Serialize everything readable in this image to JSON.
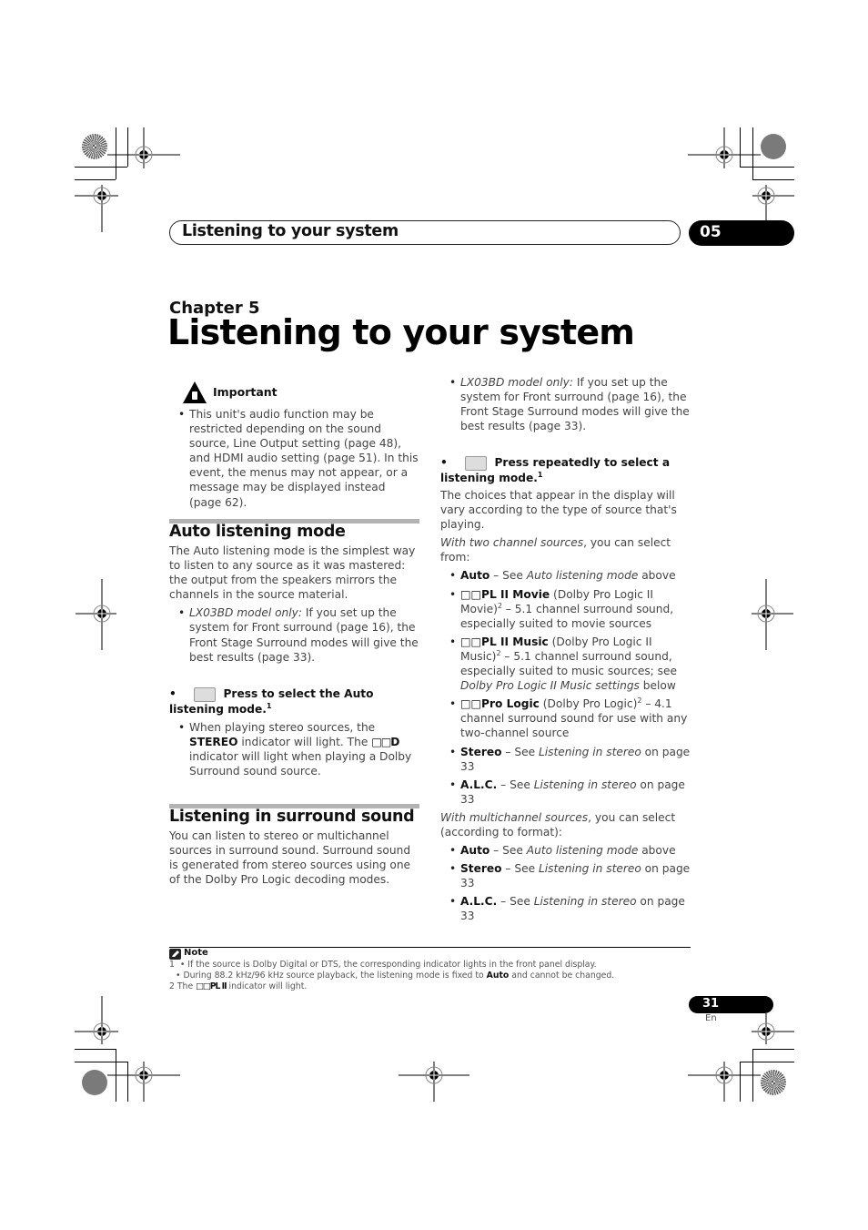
{
  "header": {
    "section_title": "Listening to your system",
    "chapter_number": "05"
  },
  "chapter": {
    "label": "Chapter 5",
    "title": "Listening to your system"
  },
  "important": {
    "label": "Important",
    "icon": "warning-hand-icon",
    "text": "This unit's audio function may be restricted depending on the sound source, Line Output setting (page 48), and HDMI audio setting (page 51). In this event, the menus may not appear, or a message may be displayed instead (page 62)."
  },
  "auto_listening": {
    "title": "Auto listening mode",
    "body": "The Auto listening mode is the simplest way to listen to any source as it was mastered: the output from the speakers mirrors the channels in the source material.",
    "note_italic": "LX03BD model only:",
    "note_text": " If you set up the system for Front surround (page 16), the Front Stage Surround modes will give the best results (page 33).",
    "step_text": "Press to select the Auto listening mode.",
    "step_sup": "1",
    "sub1": "When playing stereo sources, the ",
    "sub_bold1": "STEREO",
    "sub2": " indicator will light. The ",
    "sub_bold2": "□□D",
    "sub3": " indicator will light when playing a Dolby Surround sound source."
  },
  "surround": {
    "title": "Listening in surround sound",
    "body": "You can listen to stereo or multichannel sources in surround sound. Surround sound is generated from stereo sources using one of the Dolby Pro Logic decoding modes.",
    "note_italic": "LX03BD model only:",
    "note_text": " If you set up the system for Front surround (page 16), the Front Stage Surround modes will give the best results (page 33).",
    "step_text": "Press repeatedly to select a listening mode.",
    "step_sup": "1",
    "choices_text": "The choices that appear in the display will vary according to the type of source that's playing.",
    "two_ch_intro_italic": "With two channel sources",
    "two_ch_intro_rest": ", you can select from:",
    "two_ch_items": [
      {
        "bold": "Auto",
        "rest": " – See ",
        "italic": "Auto listening mode",
        "tail": " above"
      },
      {
        "bold": "□□PL II Movie",
        "rest": " (Dolby Pro Logic II Movie)",
        "sup": "2",
        "tail": " – 5.1 channel surround sound, especially suited to movie sources"
      },
      {
        "bold": "□□PL II Music",
        "rest": " (Dolby Pro Logic II Music)",
        "sup": "2",
        "tail": " – 5.1 channel surround sound, especially suited to music sources; see ",
        "italic": "Dolby Pro Logic II Music settings",
        "tail2": " below"
      },
      {
        "bold": "□□Pro Logic",
        "rest": " (Dolby Pro Logic)",
        "sup": "2",
        "tail": " – 4.1 channel surround sound for use with any two-channel source"
      },
      {
        "bold": "Stereo",
        "rest": " – See ",
        "italic": "Listening in stereo",
        "tail": " on page 33"
      },
      {
        "bold": "A.L.C.",
        "rest": " – See ",
        "italic": "Listening in stereo",
        "tail": " on page 33"
      }
    ],
    "multi_intro_italic": "With multichannel sources",
    "multi_intro_rest": ", you can select (according to format):",
    "multi_items": [
      {
        "bold": "Auto",
        "rest": " – See ",
        "italic": "Auto listening mode",
        "tail": " above"
      },
      {
        "bold": "Stereo",
        "rest": " – See ",
        "italic": "Listening in stereo",
        "tail": " on page 33"
      },
      {
        "bold": "A.L.C.",
        "rest": " – See ",
        "italic": "Listening in stereo",
        "tail": " on page 33"
      }
    ]
  },
  "note": {
    "label": "Note",
    "line1_num": "1",
    "line1": "• If the source is Dolby Digital or DTS, the corresponding indicator lights in the front panel display.",
    "line2_a": "• During 88.2 kHz/96 kHz source playback, the listening mode is fixed to ",
    "line2_bold": "Auto",
    "line2_b": " and cannot be changed.",
    "line3_a": "2 The ",
    "line3_bold": "□□PL II",
    "line3_b": " indicator will light."
  },
  "footer": {
    "page_number": "31",
    "language": "En"
  }
}
